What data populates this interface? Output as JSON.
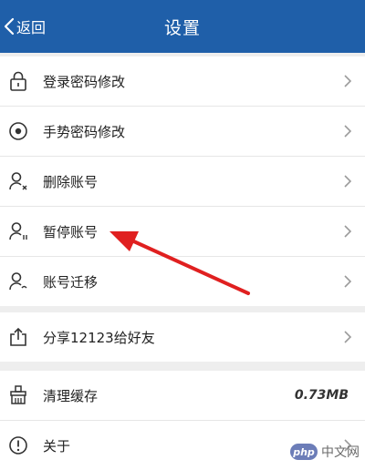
{
  "header": {
    "back_label": "返回",
    "title": "设置",
    "bg_color": "#1f5fa9"
  },
  "groups": [
    {
      "items": [
        {
          "label": "登录密码修改",
          "icon": "lock-icon"
        },
        {
          "label": "手势密码修改",
          "icon": "gesture-circle-icon"
        },
        {
          "label": "删除账号",
          "icon": "user-delete-icon"
        },
        {
          "label": "暂停账号",
          "icon": "user-pause-icon"
        },
        {
          "label": "账号迁移",
          "icon": "user-transfer-icon"
        }
      ]
    },
    {
      "items": [
        {
          "label": "分享12123给好友",
          "icon": "share-icon"
        }
      ]
    },
    {
      "items": [
        {
          "label": "清理缓存",
          "icon": "broom-icon",
          "value": "0.73MB"
        },
        {
          "label": "关于",
          "icon": "info-icon"
        }
      ]
    }
  ],
  "watermark": {
    "logo_text": "php",
    "text": "中文网"
  },
  "annotation": {
    "arrow_color": "#e02020"
  }
}
